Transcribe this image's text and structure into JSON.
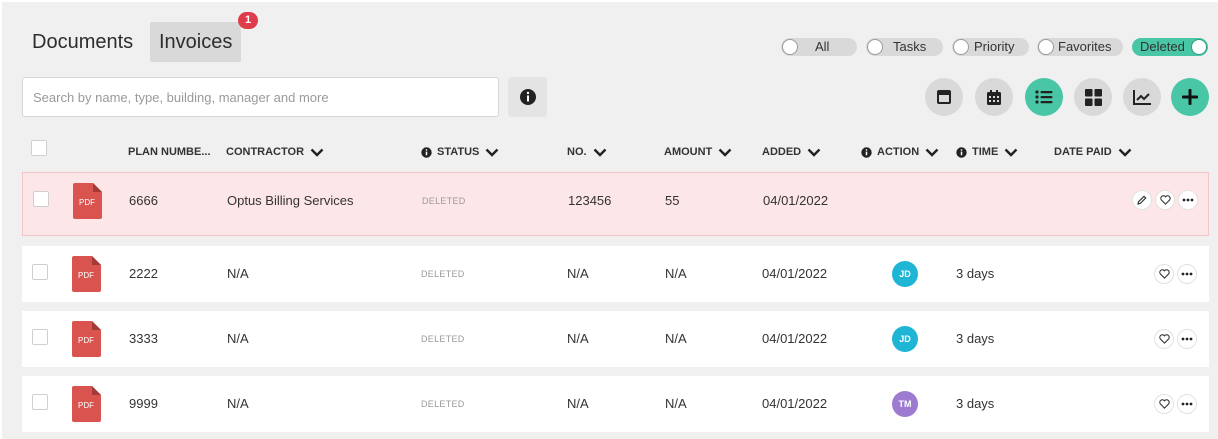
{
  "tabs": [
    {
      "label": "Documents",
      "active": false
    },
    {
      "label": "Invoices",
      "active": true,
      "badge": "1"
    }
  ],
  "filters": [
    {
      "label": "All",
      "on": false
    },
    {
      "label": "Tasks",
      "on": false
    },
    {
      "label": "Priority",
      "on": false
    },
    {
      "label": "Favorites",
      "on": false
    },
    {
      "label": "Deleted",
      "on": true
    }
  ],
  "search": {
    "placeholder": "Search by name, type, building, manager and more",
    "value": ""
  },
  "view_buttons": [
    {
      "icon": "card-view-icon",
      "active": false
    },
    {
      "icon": "calendar-icon",
      "active": false
    },
    {
      "icon": "list-view-icon",
      "active": true
    },
    {
      "icon": "grid-view-icon",
      "active": false
    },
    {
      "icon": "chart-icon",
      "active": false
    },
    {
      "icon": "add-icon",
      "active": true
    }
  ],
  "columns": {
    "plan_number": "PLAN NUMBE...",
    "contractor": "CONTRACTOR",
    "status": "STATUS",
    "no": "NO.",
    "amount": "AMOUNT",
    "added": "ADDED",
    "action": "ACTION",
    "time": "TIME",
    "date_paid": "DATE PAID"
  },
  "rows": [
    {
      "file_type": "PDF",
      "plan_number": "6666",
      "contractor": "Optus Billing Services",
      "status": "DELETED",
      "no": "123456",
      "amount": "55",
      "added": "04/01/2022",
      "action_avatar": "",
      "time": "",
      "date_paid": "",
      "highlight": true
    },
    {
      "file_type": "PDF",
      "plan_number": "2222",
      "contractor": "N/A",
      "status": "DELETED",
      "no": "N/A",
      "amount": "N/A",
      "added": "04/01/2022",
      "action_avatar": "JD",
      "time": "3 days",
      "date_paid": "",
      "highlight": false
    },
    {
      "file_type": "PDF",
      "plan_number": "3333",
      "contractor": "N/A",
      "status": "DELETED",
      "no": "N/A",
      "amount": "N/A",
      "added": "04/01/2022",
      "action_avatar": "JD",
      "time": "3 days",
      "date_paid": "",
      "highlight": false
    },
    {
      "file_type": "PDF",
      "plan_number": "9999",
      "contractor": "N/A",
      "status": "DELETED",
      "no": "N/A",
      "amount": "N/A",
      "added": "04/01/2022",
      "action_avatar": "TM",
      "time": "3 days",
      "date_paid": "",
      "highlight": false
    }
  ],
  "colors": {
    "accent": "#48c6a6",
    "badge": "#e03b4a",
    "pdf": "#d9534f",
    "avatar_jd": "#1fb6d6",
    "avatar_tm": "#9d7bd1",
    "highlight_row": "#fde6e7"
  }
}
